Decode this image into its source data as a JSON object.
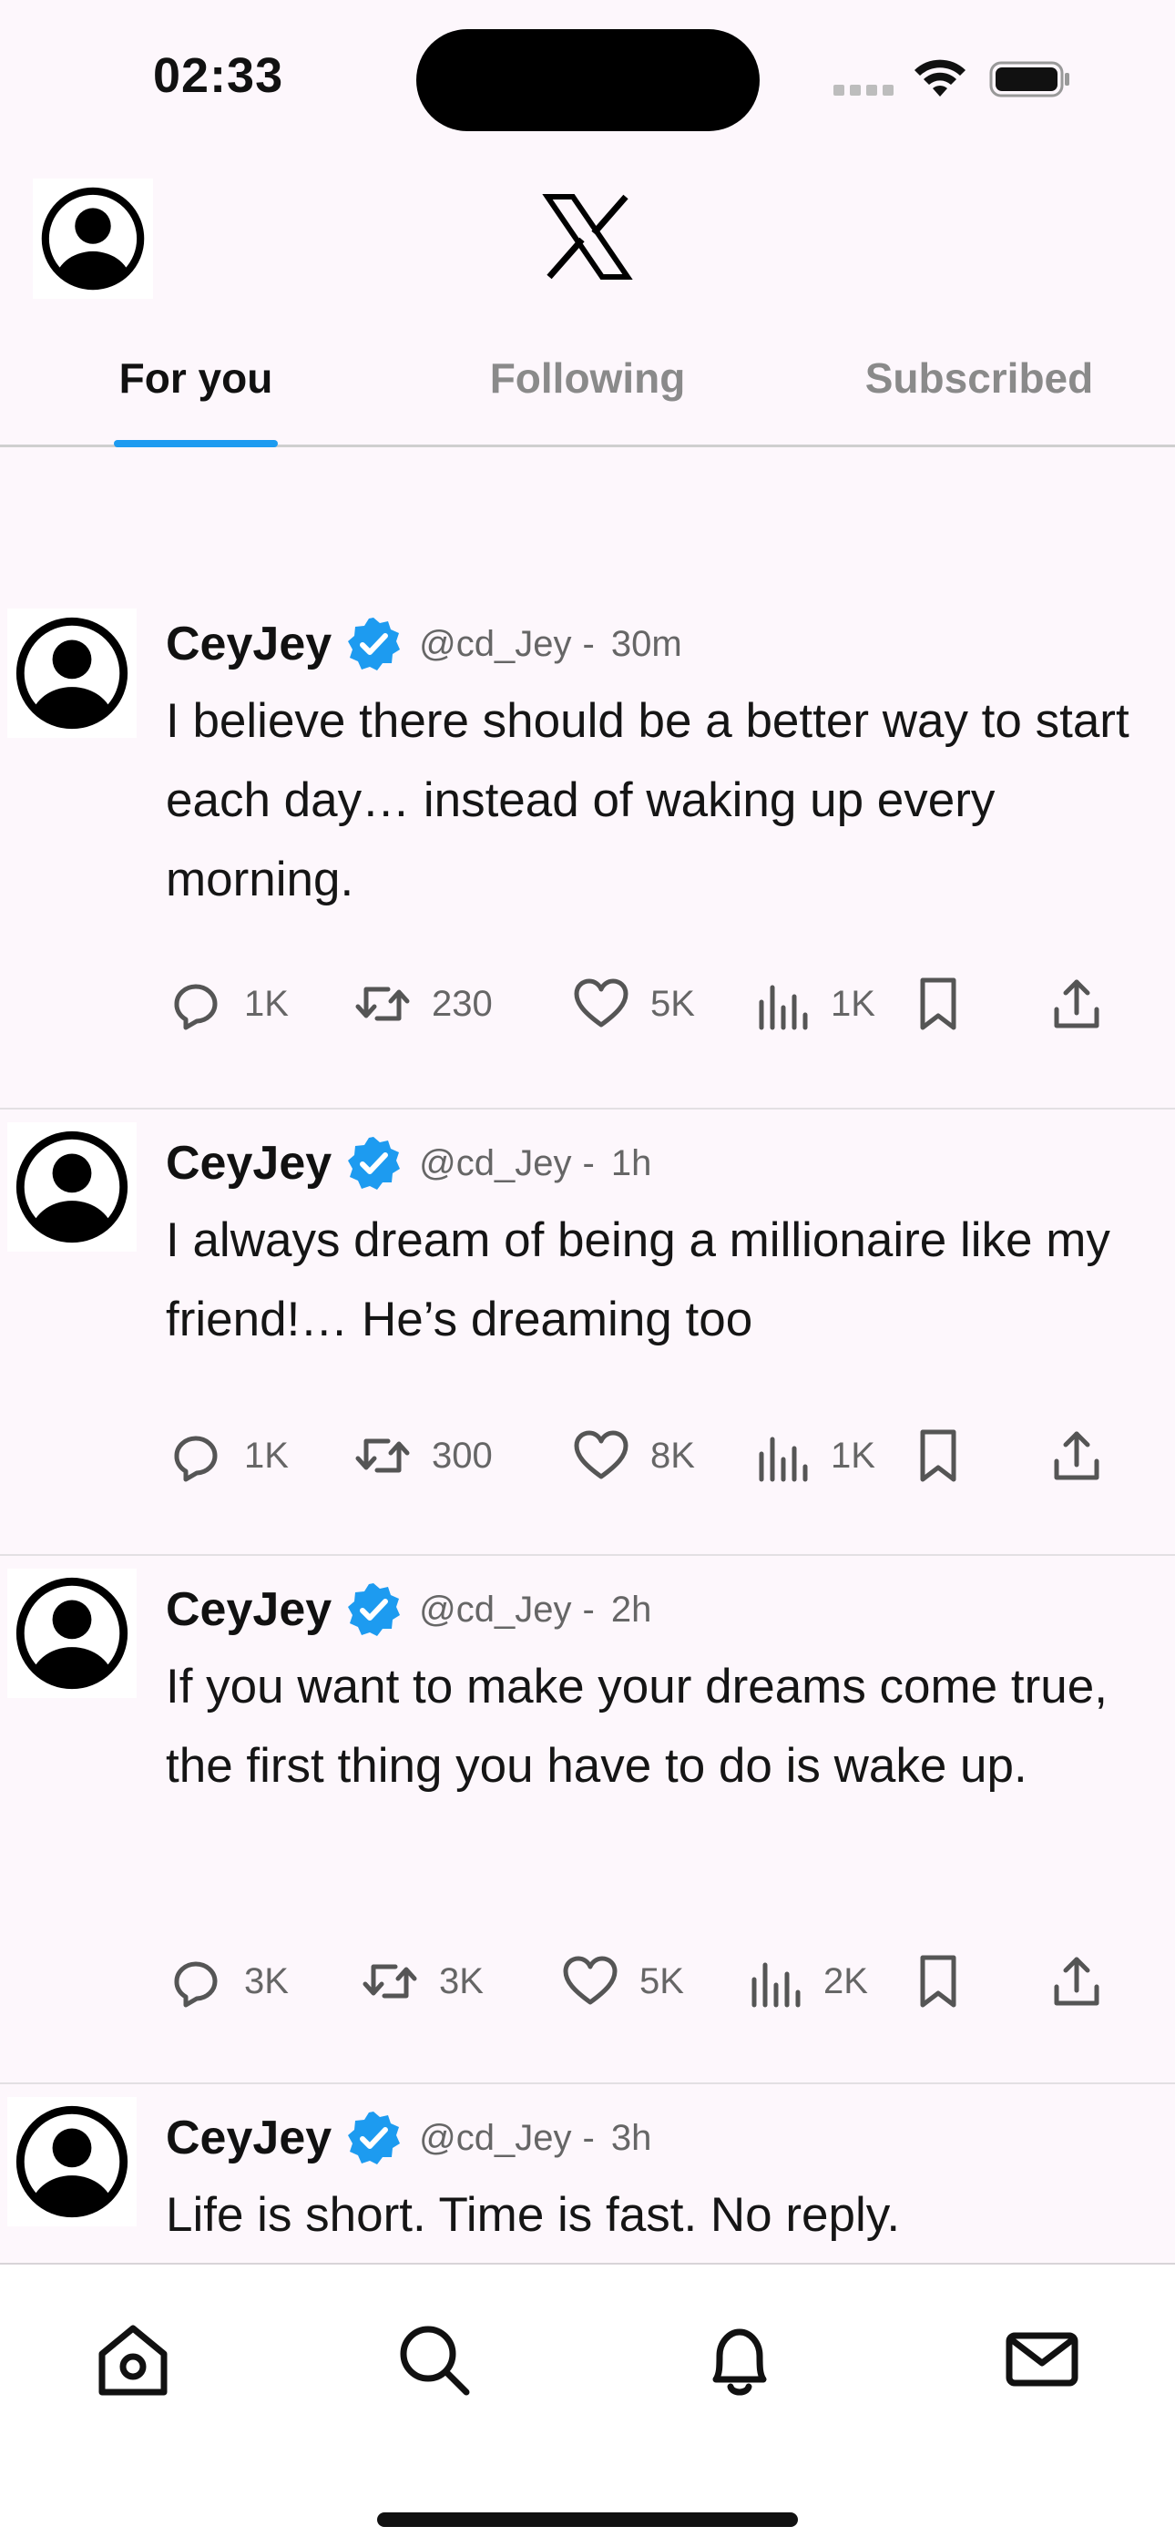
{
  "status_bar": {
    "time": "02:33"
  },
  "header": {
    "logo": "x-logo",
    "avatar_icon": "profile-avatar-icon"
  },
  "tabs": [
    {
      "label": "For you",
      "active": true
    },
    {
      "label": "Following",
      "active": false
    },
    {
      "label": "Subscribed",
      "active": false
    }
  ],
  "colors": {
    "accent": "#1d9bf0",
    "background": "#fdf7fc"
  },
  "tweets": [
    {
      "name": "CeyJey",
      "handle": "@cd_Jey",
      "separator": "-",
      "time": "30m",
      "text": "I believe there should be a better way to start each day… instead of waking up every morning.",
      "replies": "1K",
      "retweets": "230",
      "likes": "5K",
      "views": "1K"
    },
    {
      "name": "CeyJey",
      "handle": "@cd_Jey",
      "separator": "-",
      "time": "1h",
      "text": "I always dream of being a millionaire like my friend!… He’s dreaming too",
      "replies": "1K",
      "retweets": "300",
      "likes": "8K",
      "views": "1K"
    },
    {
      "name": "CeyJey",
      "handle": "@cd_Jey",
      "separator": "-",
      "time": "2h",
      "text": "If you want to make your dreams come true, the first thing you have to do is wake up.",
      "replies": "3K",
      "retweets": "3K",
      "likes": "5K",
      "views": "2K"
    },
    {
      "name": "CeyJey",
      "handle": "@cd_Jey",
      "separator": "-",
      "time": "3h",
      "text": "Life is short. Time is fast. No reply."
    }
  ],
  "bottom_nav": [
    "home-icon",
    "search-icon",
    "notifications-icon",
    "messages-icon"
  ]
}
